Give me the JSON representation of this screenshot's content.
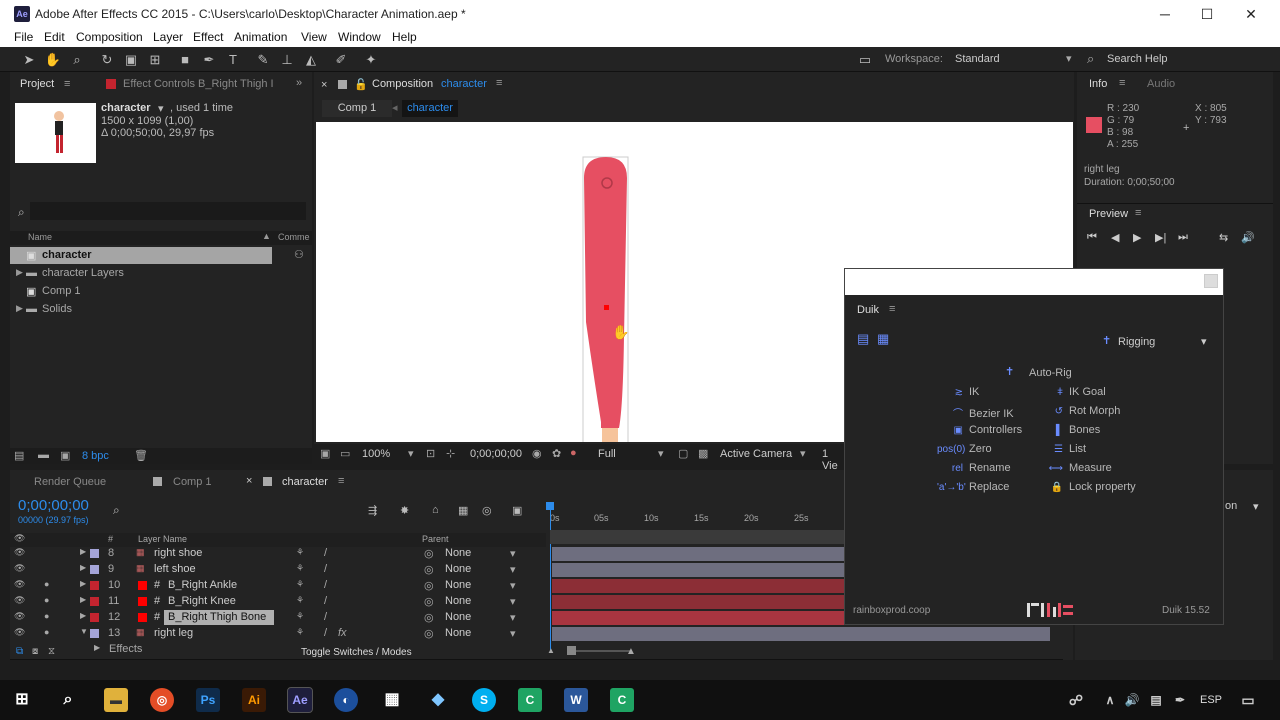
{
  "window": {
    "title": "Adobe After Effects CC 2015 - C:\\Users\\carlo\\Desktop\\Character Animation.aep *",
    "app_icon": "Ae",
    "minimize": "─",
    "maximize": "☐",
    "close": "✕"
  },
  "menu": [
    "File",
    "Edit",
    "Composition",
    "Layer",
    "Effect",
    "Animation",
    "View",
    "Window",
    "Help"
  ],
  "toolbar": {
    "workspace_label": "Workspace:",
    "workspace_value": "Standard",
    "search_help": "Search Help"
  },
  "project": {
    "tab": "Project",
    "effect_controls_tab": "Effect Controls B_Right Thigh I",
    "item_name": "character",
    "used": ", used 1 time",
    "dims": "1500 x 1099 (1,00)",
    "duration": "Δ 0;00;50;00, 29,97 fps",
    "col_name": "Name",
    "col_comment": "Comme",
    "items": [
      {
        "label": "character",
        "selected": true
      },
      {
        "label": "character Layers",
        "selected": false
      },
      {
        "label": "Comp 1",
        "selected": false
      },
      {
        "label": "Solids",
        "selected": false
      }
    ],
    "bpc": "8 bpc"
  },
  "composition": {
    "tab_prefix": "Composition",
    "tab_name": "character",
    "breadcrumb_1": "Comp 1",
    "breadcrumb_2": "character",
    "zoom": "100%",
    "timecode": "0;00;00;00",
    "resolution": "Full",
    "camera": "Active Camera",
    "views": "1 Vie"
  },
  "info": {
    "tab": "Info",
    "audio_tab": "Audio",
    "r": "R : 230",
    "g": "G : 79",
    "b": "B : 98",
    "a": "A : 255",
    "x": "X : 805",
    "y": "Y : 793",
    "layer": "right leg",
    "duration": "Duration: 0;00;50;00",
    "swatch_color": "#e64f62"
  },
  "preview": {
    "tab": "Preview"
  },
  "duik": {
    "title": "Duik",
    "mode": "Rigging",
    "auto_rig": "Auto-Rig",
    "left": [
      "IK",
      "Bezier IK",
      "Controllers",
      "Zero",
      "Rename",
      "Replace"
    ],
    "right": [
      "IK Goal",
      "Rot Morph",
      "Bones",
      "List",
      "Measure",
      "Lock property"
    ],
    "footer_left": "rainboxprod.coop",
    "footer_logo": "RainBox",
    "footer_right": "Duik 15.52"
  },
  "timeline": {
    "render_queue": "Render Queue",
    "comp1_tab": "Comp 1",
    "char_tab": "character",
    "timecode": "0;00;00;00",
    "fps": "00000 (29.97 fps)",
    "col_layer_name": "Layer Name",
    "col_parent": "Parent",
    "ticks": [
      "0s",
      "05s",
      "10s",
      "15s",
      "20s",
      "25s"
    ],
    "layers": [
      {
        "num": "8",
        "name": "right shoe",
        "parent": "None",
        "color": "#a4a4d8"
      },
      {
        "num": "9",
        "name": "left shoe",
        "parent": "None",
        "color": "#a4a4d8"
      },
      {
        "num": "10",
        "name": "B_Right Ankle",
        "parent": "None",
        "color": "#c3242f"
      },
      {
        "num": "11",
        "name": "B_Right Knee",
        "parent": "None",
        "color": "#c3242f"
      },
      {
        "num": "12",
        "name": "B_Right Thigh Bone",
        "parent": "None",
        "color": "#c3242f"
      },
      {
        "num": "13",
        "name": "right leg",
        "parent": "None",
        "color": "#a4a4d8"
      }
    ],
    "effects_label": "Effects",
    "toggle_label": "Toggle Switches / Modes"
  },
  "taskbar": {
    "lang": "ESP"
  }
}
